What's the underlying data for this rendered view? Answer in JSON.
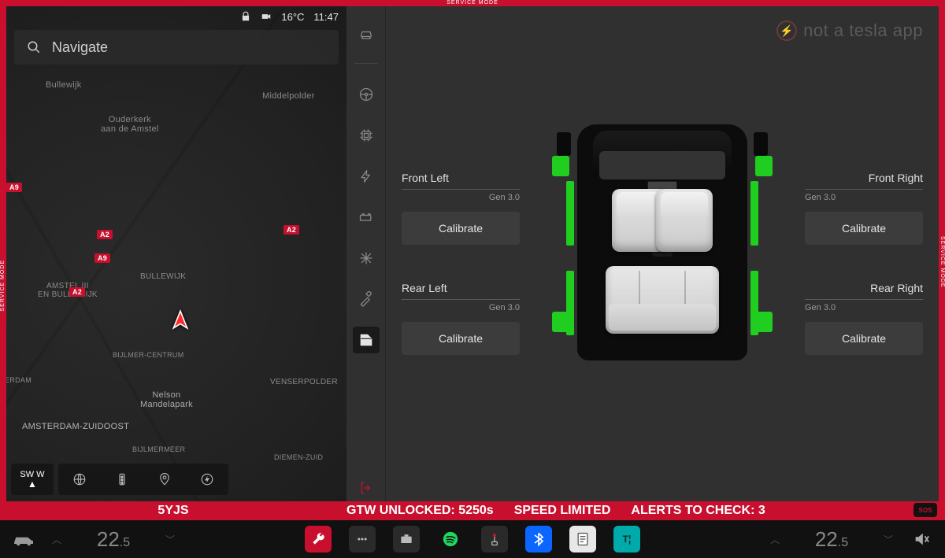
{
  "mode_label": "SERVICE MODE",
  "watermark": "not a tesla app",
  "status_bar": {
    "temperature": "16°C",
    "time": "11:47"
  },
  "search": {
    "placeholder": "Navigate"
  },
  "map": {
    "labels": {
      "bullewijk": "Bullewijk",
      "middelpolder": "Middelpolder",
      "ouderkerk": "Ouderkerk\naan de Amstel",
      "amstel_bullewijk": "AMSTEL III\nEN BULLEWIJK",
      "bullewijk2": "BULLEWIJK",
      "nelson": "Nelson\nMandelapark",
      "venserpolder": "VENSERPOLDER",
      "zuidoost": "AMSTERDAM-ZUIDOOST",
      "bijlmer_centrum": "BIJLMER-CENTRUM",
      "bijlmermeer": "BIJLMERMEER",
      "diemen": "DIEMEN-ZUID",
      "erdam": "ERDAM"
    },
    "roads": {
      "a2": "A2",
      "a9": "A9"
    },
    "compass": "SW W"
  },
  "svc_nav": {
    "items": [
      "vehicle",
      "steering",
      "chip",
      "charging",
      "battery",
      "hvac",
      "tools",
      "doors"
    ],
    "active": "doors"
  },
  "windows": {
    "fl": {
      "title": "Front Left",
      "gen": "Gen 3.0",
      "btn": "Calibrate"
    },
    "fr": {
      "title": "Front Right",
      "gen": "Gen 3.0",
      "btn": "Calibrate"
    },
    "rl": {
      "title": "Rear Left",
      "gen": "Gen 3.0",
      "btn": "Calibrate"
    },
    "rr": {
      "title": "Rear Right",
      "gen": "Gen 3.0",
      "btn": "Calibrate"
    }
  },
  "red_strip": {
    "vin": "5YJS",
    "gtw": "GTW UNLOCKED: 5250s",
    "speed": "SPEED LIMITED",
    "alerts": "ALERTS TO CHECK: 3",
    "sos": "SOS"
  },
  "dock": {
    "temp_left": {
      "whole": "22",
      "dec": ".5"
    },
    "temp_right": {
      "whole": "22",
      "dec": ".5"
    },
    "apps": [
      "service",
      "menu",
      "dashcam",
      "spotify",
      "arcade",
      "bluetooth",
      "calendar",
      "energy"
    ]
  },
  "colors": {
    "accent_red": "#c8102e",
    "window_ok": "#1fce1f"
  }
}
